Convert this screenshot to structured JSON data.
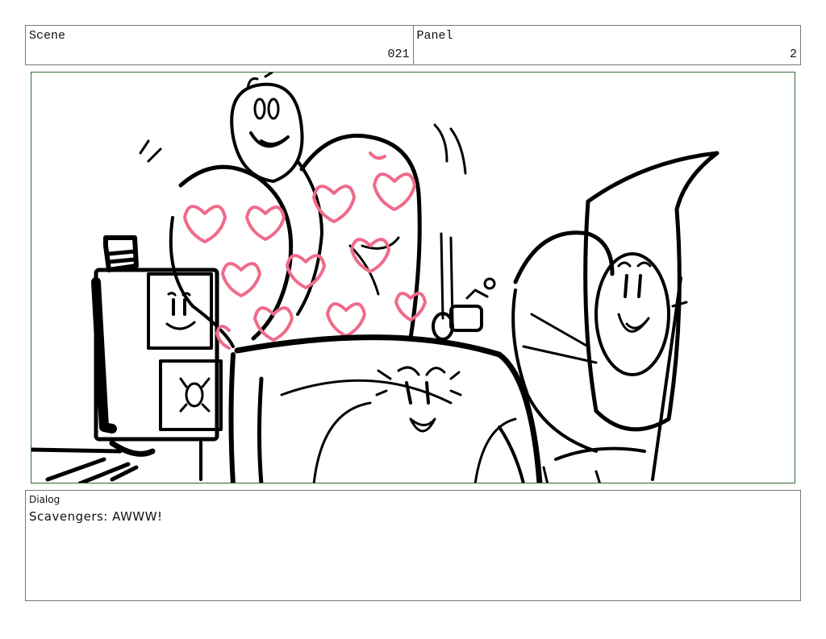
{
  "header": {
    "scene_label": "Scene",
    "scene_value": "021",
    "panel_label": "Panel",
    "panel_value": "2"
  },
  "dialog": {
    "label": "Dialog",
    "text": "Scavengers: AWWW!"
  },
  "colors": {
    "ink": "#000000",
    "hearts": "#f06a8a",
    "panel_border": "#2f6b2f",
    "cell_border": "#777777"
  }
}
